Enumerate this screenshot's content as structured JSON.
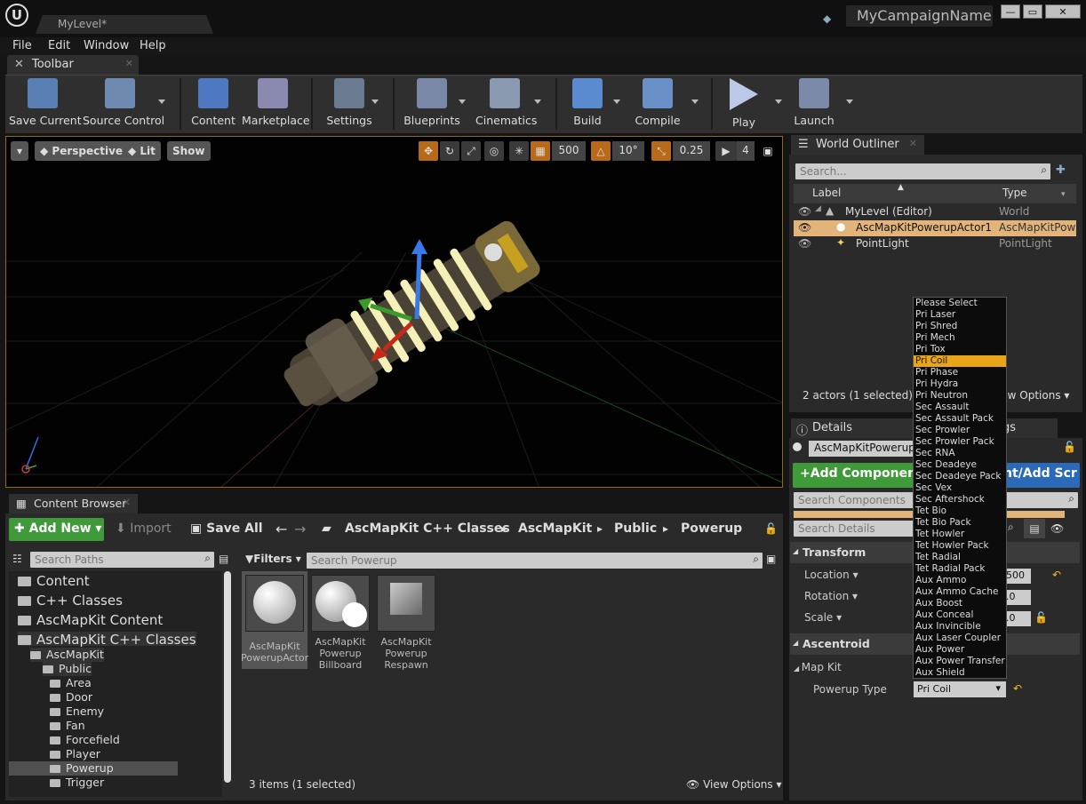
{
  "window": {
    "level_tab": "MyLevel*",
    "project_name": "MyCampaignName"
  },
  "menu": [
    "File",
    "Edit",
    "Window",
    "Help"
  ],
  "toolbar": {
    "tab_label": "Toolbar",
    "items": [
      {
        "label": "Save Current",
        "icon": "save-icon"
      },
      {
        "label": "Source Control",
        "icon": "source-control-icon"
      },
      {
        "label": "Content",
        "icon": "content-icon"
      },
      {
        "label": "Marketplace",
        "icon": "marketplace-icon"
      },
      {
        "label": "Settings",
        "icon": "settings-icon"
      },
      {
        "label": "Blueprints",
        "icon": "blueprints-icon"
      },
      {
        "label": "Cinematics",
        "icon": "cinematics-icon"
      },
      {
        "label": "Build",
        "icon": "build-icon"
      },
      {
        "label": "Compile",
        "icon": "compile-icon"
      },
      {
        "label": "Play",
        "icon": "play-icon"
      },
      {
        "label": "Launch",
        "icon": "launch-icon"
      }
    ]
  },
  "viewport": {
    "perspective": "Perspective",
    "lit": "Lit",
    "show": "Show",
    "grid_snap": "500",
    "rot_snap": "10°",
    "scale_snap": "0.25",
    "cam_speed": "4"
  },
  "outliner": {
    "tab_label": "World Outliner",
    "search_placeholder": "Search...",
    "col_label": "Label",
    "col_type": "Type",
    "rows": [
      {
        "label": "MyLevel (Editor)",
        "type": "World"
      },
      {
        "label": "AscMapKitPowerupActor1",
        "type": "AscMapKitPowe"
      },
      {
        "label": "PointLight",
        "type": "PointLight"
      }
    ],
    "status": "2 actors (1 selected)",
    "view_options": "View Options"
  },
  "details": {
    "tab_label": "Details",
    "tab2_suffix": "gs",
    "actor_name": "AscMapKitPowerupA",
    "add_component": "Add Component",
    "blueprint_btn": "nt/Add Scr",
    "search_components": "Search Components",
    "search_details": "Search Details",
    "transform": "Transform",
    "location": "Location",
    "location_val": "500",
    "rotation": "Rotation",
    "rotation_val": ".0",
    "scale": "Scale",
    "scale_val": ".0",
    "ascentroid": "Ascentroid",
    "map_kit": "Map Kit",
    "powerup_type": "Powerup Type",
    "powerup_value": "Pri Coil"
  },
  "dropdown": {
    "selected": "Pri Coil",
    "options": [
      "Please Select",
      "Pri Laser",
      "Pri Shred",
      "Pri Mech",
      "Pri Tox",
      "Pri Coil",
      "Pri Phase",
      "Pri Hydra",
      "Pri Neutron",
      "Sec Assault",
      "Sec Assault Pack",
      "Sec Prowler",
      "Sec Prowler Pack",
      "Sec RNA",
      "Sec Deadeye",
      "Sec Deadeye Pack",
      "Sec Vex",
      "Sec Aftershock",
      "Tet Bio",
      "Tet Bio Pack",
      "Tet Howler",
      "Tet Howler Pack",
      "Tet Radial",
      "Tet Radial Pack",
      "Aux Ammo",
      "Aux Ammo Cache",
      "Aux Boost",
      "Aux Conceal",
      "Aux Invincible",
      "Aux Laser Coupler",
      "Aux Power",
      "Aux Power Transfer",
      "Aux Shield"
    ]
  },
  "content_browser": {
    "tab_label": "Content Browser",
    "add_new": "Add New",
    "import": "Import",
    "save_all": "Save All",
    "path": [
      "AscMapKit C++ Classes",
      "AscMapKit",
      "Public",
      "Powerup"
    ],
    "search_paths": "Search Paths",
    "filters": "Filters",
    "search_assets": "Search Powerup",
    "tree": [
      {
        "label": "Content",
        "level": 0
      },
      {
        "label": "C++ Classes",
        "level": 0
      },
      {
        "label": "AscMapKit Content",
        "level": 0
      },
      {
        "label": "AscMapKit C++ Classes",
        "level": 0
      },
      {
        "label": "AscMapKit",
        "level": 1
      },
      {
        "label": "Public",
        "level": 2
      },
      {
        "label": "Area",
        "level": 3
      },
      {
        "label": "Door",
        "level": 3
      },
      {
        "label": "Enemy",
        "level": 3
      },
      {
        "label": "Fan",
        "level": 3
      },
      {
        "label": "Forcefield",
        "level": 3
      },
      {
        "label": "Player",
        "level": 3
      },
      {
        "label": "Powerup",
        "level": 3
      },
      {
        "label": "Trigger",
        "level": 3
      }
    ],
    "assets": [
      {
        "line1": "AscMapKit",
        "line2": "PowerupActor",
        "line3": ""
      },
      {
        "line1": "AscMapKit",
        "line2": "Powerup",
        "line3": "Billboard"
      },
      {
        "line1": "AscMapKit",
        "line2": "Powerup",
        "line3": "Respawn"
      }
    ],
    "status": "3 items (1 selected)",
    "view_options": "View Options"
  }
}
